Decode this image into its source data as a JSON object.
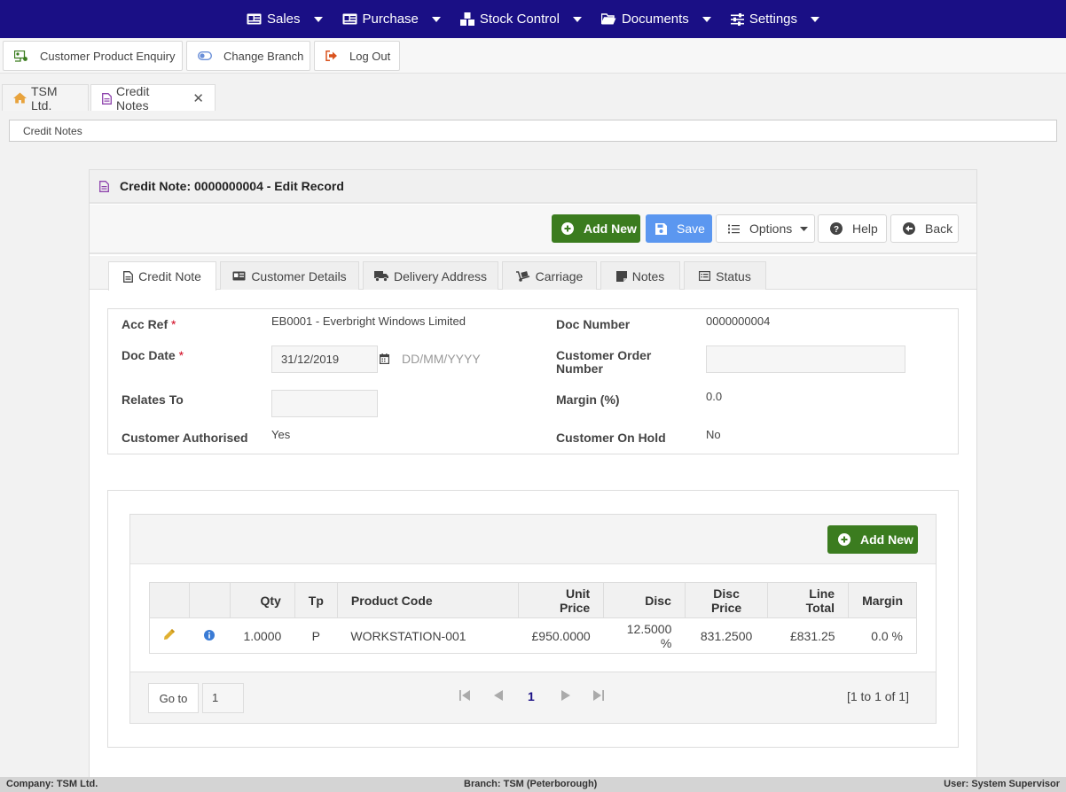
{
  "topnav": {
    "items": [
      {
        "label": "Sales",
        "icon": "id-card-icon"
      },
      {
        "label": "Purchase",
        "icon": "id-card-icon"
      },
      {
        "label": "Stock Control",
        "icon": "cubes-icon"
      },
      {
        "label": "Documents",
        "icon": "folder-open-icon"
      },
      {
        "label": "Settings",
        "icon": "sliders-icon"
      }
    ],
    "background": "#1a0f85"
  },
  "actions": {
    "customer_enquiry": "Customer Product Enquiry",
    "change_branch": "Change Branch",
    "log_out": "Log Out"
  },
  "page_tabs": [
    {
      "label": "TSM Ltd.",
      "icon": "home-icon"
    },
    {
      "label": "Credit Notes",
      "icon": "file-icon",
      "active": true
    }
  ],
  "breadcrumb": "Credit Notes",
  "panel": {
    "title": "Credit Note: 0000000004 - Edit Record",
    "toolbar": {
      "add_new": "Add New",
      "save": "Save",
      "options": "Options",
      "help": "Help",
      "back": "Back"
    },
    "tabs": [
      {
        "label": "Credit Note",
        "active": true
      },
      {
        "label": "Customer Details"
      },
      {
        "label": "Delivery Address"
      },
      {
        "label": "Carriage"
      },
      {
        "label": "Notes"
      },
      {
        "label": "Status"
      }
    ]
  },
  "form": {
    "acc_ref": {
      "label": "Acc Ref",
      "required": "*",
      "value": "EB0001 - Everbright Windows Limited"
    },
    "doc_number": {
      "label": "Doc Number",
      "value": "0000000004"
    },
    "doc_date": {
      "label": "Doc Date",
      "required": "*",
      "value": "31/12/2019",
      "placeholder": "DD/MM/YYYY"
    },
    "customer_order_number": {
      "label_line1": "Customer Order",
      "label_line2": "Number",
      "value": ""
    },
    "relates_to": {
      "label": "Relates To",
      "value": ""
    },
    "margin": {
      "label": "Margin (%)",
      "value": "0.0"
    },
    "customer_authorised": {
      "label": "Customer Authorised",
      "value": "Yes"
    },
    "customer_on_hold": {
      "label": "Customer On Hold",
      "value": "No"
    }
  },
  "lines": {
    "add_new": "Add New",
    "columns": [
      "",
      "",
      "Qty",
      "Tp",
      "Product Code",
      "Unit Price",
      "Disc",
      "Disc Price",
      "Line Total",
      "Margin"
    ],
    "rows": [
      {
        "qty": "1.0000",
        "tp": "P",
        "product_code": "WORKSTATION-001",
        "unit_price": "£950.0000",
        "disc": "12.5000 %",
        "disc_price": "831.2500",
        "line_total": "£831.25",
        "margin": "0.0 %"
      }
    ],
    "pager": {
      "goto_label": "Go to",
      "goto_value": "1",
      "current_page": "1",
      "info": "[1 to 1 of 1]"
    }
  },
  "statusbar": {
    "company": "Company: TSM Ltd.",
    "branch": "Branch: TSM (Peterborough)",
    "user": "User: System Supervisor"
  },
  "colors": {
    "nav": "#1a0f85",
    "green_button": "#3b7c1f",
    "blue_button": "#5b97f0",
    "file_icon": "#8e44ad",
    "home_icon": "#e8a33d",
    "edit_icon": "#e0b030",
    "info_icon": "#3a7bd5"
  }
}
